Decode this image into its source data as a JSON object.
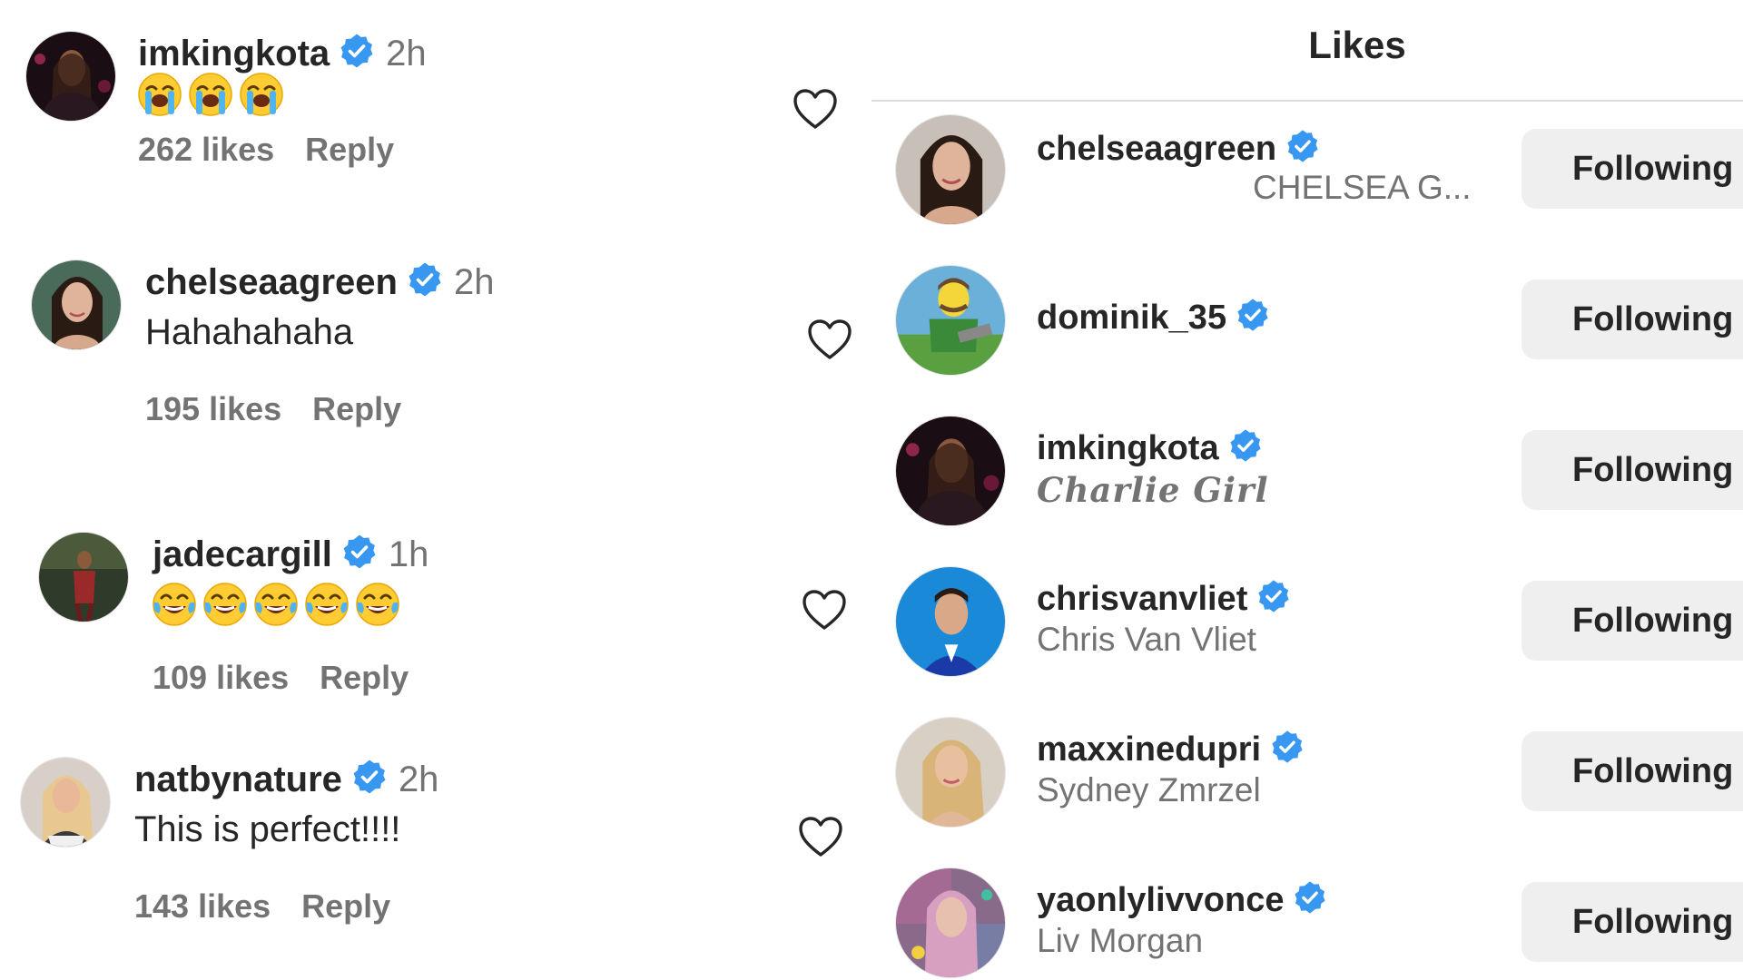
{
  "comments": [
    {
      "username": "imkingkota",
      "time": "2h",
      "text": "",
      "emoji": "loudly-crying-face",
      "emoji_count": 3,
      "likes": "262 likes",
      "reply": "Reply"
    },
    {
      "username": "chelseaagreen",
      "time": "2h",
      "text": "Hahahahaha",
      "likes": "195 likes",
      "reply": "Reply"
    },
    {
      "username": "jadecargill",
      "time": "1h",
      "text": "",
      "emoji": "face-with-tears-of-joy",
      "emoji_count": 5,
      "likes": "109 likes",
      "reply": "Reply"
    },
    {
      "username": "natbynature",
      "time": "2h",
      "text": "This is perfect!!!!",
      "likes": "143 likes",
      "reply": "Reply"
    }
  ],
  "likes_panel": {
    "title": "Likes",
    "users": [
      {
        "username": "chelseaagreen",
        "full_name": "CHELSEA G...",
        "button": "Following"
      },
      {
        "username": "dominik_35",
        "full_name": "",
        "button": "Following"
      },
      {
        "username": "imkingkota",
        "full_name": "Charlie Girl",
        "button": "Following"
      },
      {
        "username": "chrisvanvliet",
        "full_name": "Chris Van Vliet",
        "button": "Following"
      },
      {
        "username": "maxxinedupri",
        "full_name": "Sydney Zmrzel",
        "button": "Following"
      },
      {
        "username": "yaonlylivvonce",
        "full_name": "Liv Morgan",
        "button": "Following"
      }
    ]
  },
  "colors": {
    "verified": "#3897f0",
    "secondary_text": "#737373",
    "button_bg": "#efefef",
    "divider": "#dbdbdb"
  }
}
